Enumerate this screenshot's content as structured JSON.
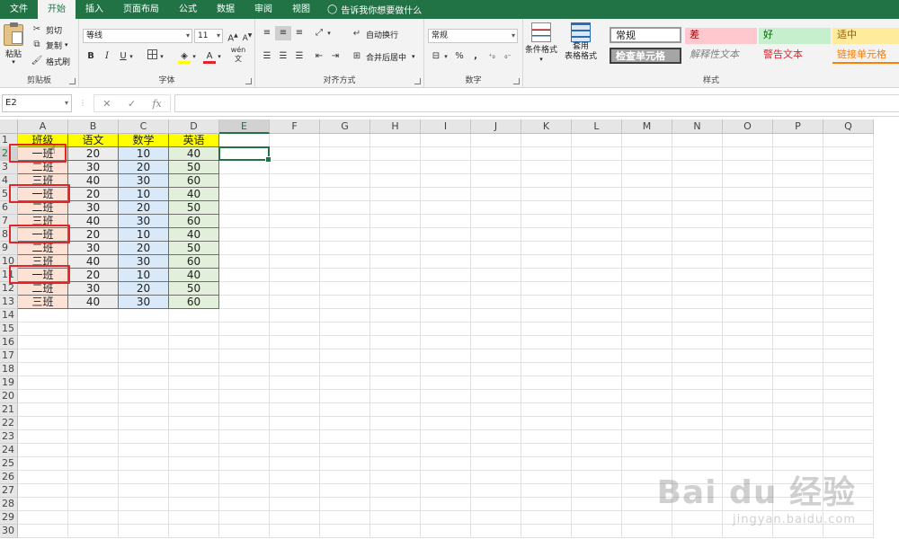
{
  "tabs": [
    {
      "label": "文件",
      "active": false
    },
    {
      "label": "开始",
      "active": true
    },
    {
      "label": "插入",
      "active": false
    },
    {
      "label": "页面布局",
      "active": false
    },
    {
      "label": "公式",
      "active": false
    },
    {
      "label": "数据",
      "active": false
    },
    {
      "label": "审阅",
      "active": false
    },
    {
      "label": "视图",
      "active": false
    }
  ],
  "tellme": "告诉我你想要做什么",
  "ribbon": {
    "clipboard": {
      "paste": "粘贴",
      "cut": "剪切",
      "copy": "复制",
      "painter": "格式刷",
      "label": "剪贴板"
    },
    "font": {
      "name": "等线",
      "size": "11",
      "grow": "A",
      "shrink": "A",
      "bold": "B",
      "italic": "I",
      "underline": "U",
      "label": "字体",
      "font_color": "A",
      "phonetic": "wén",
      "phonetic_sub": "文"
    },
    "align": {
      "wrap": "自动换行",
      "merge": "合并后居中",
      "label": "对齐方式"
    },
    "number": {
      "format": "常规",
      "percent": "%",
      "comma": ",",
      "label": "数字"
    },
    "styles": {
      "cond": "条件格式",
      "table_line1": "套用",
      "table_line2": "表格格式",
      "label": "样式",
      "normal": "常规",
      "bad": "差",
      "good": "好",
      "neutral": "适中",
      "check": "检查单元格",
      "explain": "解释性文本",
      "warning": "警告文本",
      "link": "链接单元格"
    }
  },
  "formula": {
    "namebox": "E2",
    "cancel": "✕",
    "enter": "✓",
    "fx": "fx",
    "content": ""
  },
  "columns": [
    "A",
    "B",
    "C",
    "D",
    "E",
    "F",
    "G",
    "H",
    "I",
    "J",
    "K",
    "L",
    "M",
    "N",
    "O",
    "P",
    "Q"
  ],
  "table": {
    "headers": [
      "班级",
      "语文",
      "数学",
      "英语"
    ],
    "rows": [
      [
        "一班",
        "20",
        "10",
        "40"
      ],
      [
        "二班",
        "30",
        "20",
        "50"
      ],
      [
        "三班",
        "40",
        "30",
        "60"
      ],
      [
        "一班",
        "20",
        "10",
        "40"
      ],
      [
        "二班",
        "30",
        "20",
        "50"
      ],
      [
        "三班",
        "40",
        "30",
        "60"
      ],
      [
        "一班",
        "20",
        "10",
        "40"
      ],
      [
        "二班",
        "30",
        "20",
        "50"
      ],
      [
        "三班",
        "40",
        "30",
        "60"
      ],
      [
        "一班",
        "20",
        "10",
        "40"
      ],
      [
        "二班",
        "30",
        "20",
        "50"
      ],
      [
        "三班",
        "40",
        "30",
        "60"
      ]
    ]
  },
  "colors": {
    "header_bg": "#ffff00",
    "col_a_bg": "#fbe2d5",
    "col_b_bg": "#ededed",
    "col_c_bg": "#dae9f8",
    "col_d_bg": "#e2efda",
    "accent": "#217346",
    "highlight_box": "#e0252b"
  },
  "watermark": {
    "main": "Bai du 经验",
    "sub": "jingyan.baidu.com"
  }
}
